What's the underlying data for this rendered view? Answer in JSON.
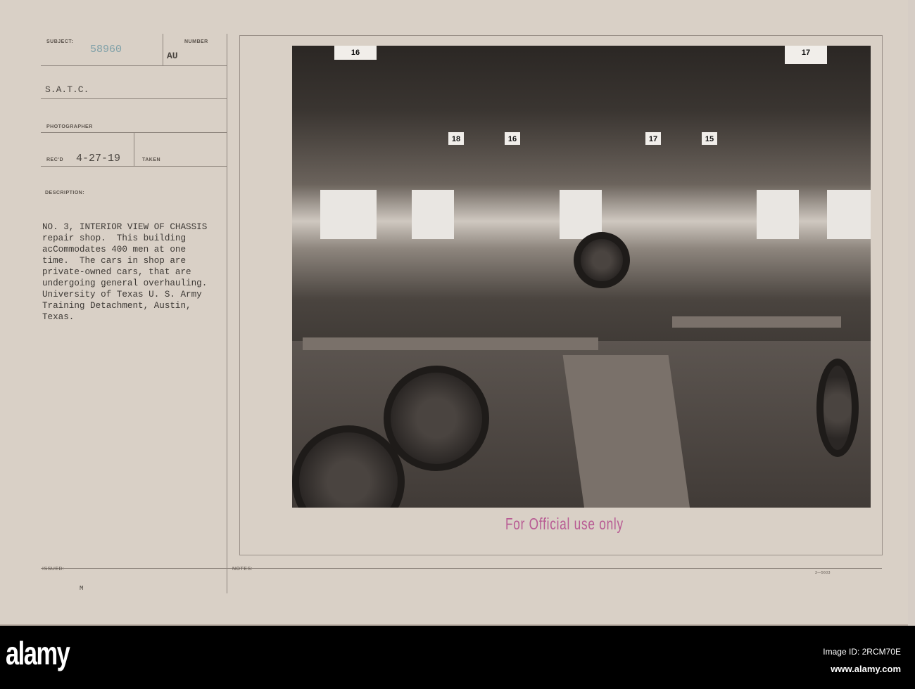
{
  "card": {
    "subject_label": "SUBJECT:",
    "subject_number": "58960",
    "number_label": "NUMBER",
    "number_value": "AU",
    "unit": "S.A.T.C.",
    "photographer_label": "PHOTOGRAPHER",
    "recd_label": "REC'D",
    "recd_date": "4-27-19",
    "taken_label": "TAKEN",
    "description_label": "DESCRIPTION:",
    "description": "NO. 3, INTERIOR VIEW OF CHASSIS\nrepair shop.  This building\nacCommodates 400 men at one\ntime.  The cars in shop are\nprivate-owned cars, that are\nundergoing general overhauling.\nUniversity of Texas U. S. Army\nTraining Detachment, Austin,\nTexas.",
    "issued_label": "ISSUED:",
    "issued_mark": "M",
    "notes_label": "NOTES:",
    "form_number": "3—5603",
    "stamp": "For Official use only"
  },
  "photo": {
    "section_signs": [
      "18",
      "16",
      "17",
      "15"
    ],
    "top_signs": [
      "16",
      "17"
    ]
  },
  "footer": {
    "logo": "alamy",
    "image_id": "Image ID: 2RCM70E",
    "url": "www.alamy.com"
  }
}
